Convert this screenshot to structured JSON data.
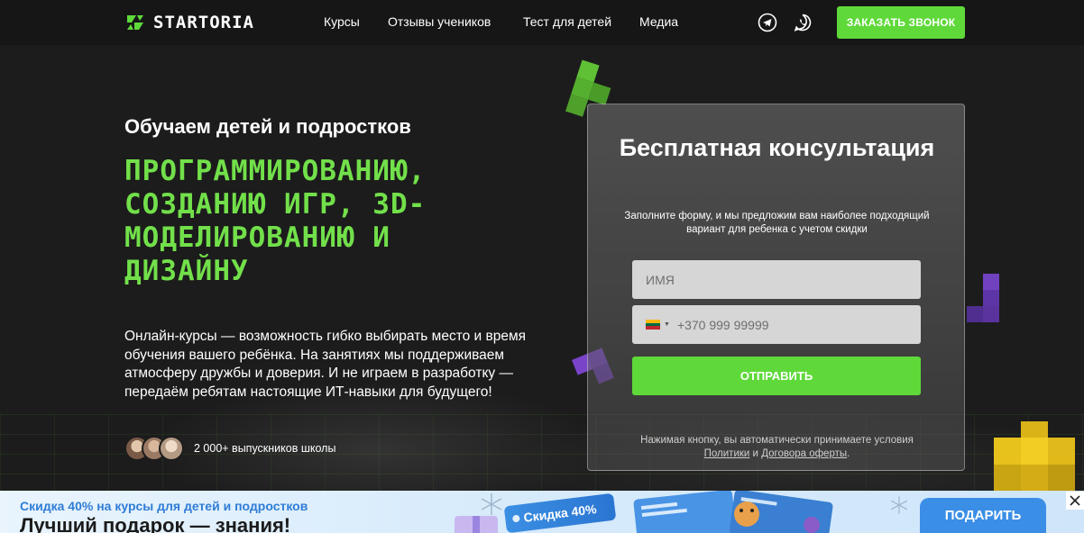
{
  "header": {
    "logo_text": "STARTORIA",
    "nav": [
      "Курсы",
      "Отзывы учеников",
      "Тест для детей",
      "Медиа"
    ],
    "call_button": "ЗАКАЗАТЬ ЗВОНОК"
  },
  "hero": {
    "subtitle": "Обучаем детей и подростков",
    "title": "ПРОГРАММИРОВАНИЮ, СОЗДАНИЮ ИГР, 3D-МОДЕЛИРОВАНИЮ И ДИЗАЙНУ",
    "description": "Онлайн-курсы — возможность гибко выбирать место и время обучения вашего ребёнка. На занятиях мы поддерживаем атмосферу дружбы и доверия. И не играем в разработку — передаём ребятам настоящие ИТ-навыки для будущего!",
    "graduates": "2 000+ выпускников школы"
  },
  "form": {
    "title": "Бесплатная консультация",
    "note": "Заполните форму, и мы предложим вам наиболее подходящий вариант для ребенка с учетом скидки",
    "name_placeholder": "ИМЯ",
    "phone_placeholder": "+370 999 99999",
    "submit": "ОТПРАВИТЬ",
    "legal_prefix": "Нажимая кнопку, вы автоматически принимаете условия",
    "legal_link1": "Политики",
    "legal_and": "и",
    "legal_link2": "Договора оферты",
    "legal_suffix": "."
  },
  "promo": {
    "line1": "Скидка 40% на курсы для детей и подростков",
    "line2": "Лучший подарок — знания!",
    "tag": "Скидка 40%",
    "button": "ПОДАРИТЬ"
  },
  "colors": {
    "accent_green": "#5fd93a",
    "title_green": "#72e04a",
    "background": "#1c1c1c",
    "promo_blue": "#3a8ee6"
  },
  "icons": {
    "telegram": "telegram-icon",
    "whatsapp": "whatsapp-icon",
    "close": "close-icon",
    "flag": "lithuania-flag-icon"
  }
}
